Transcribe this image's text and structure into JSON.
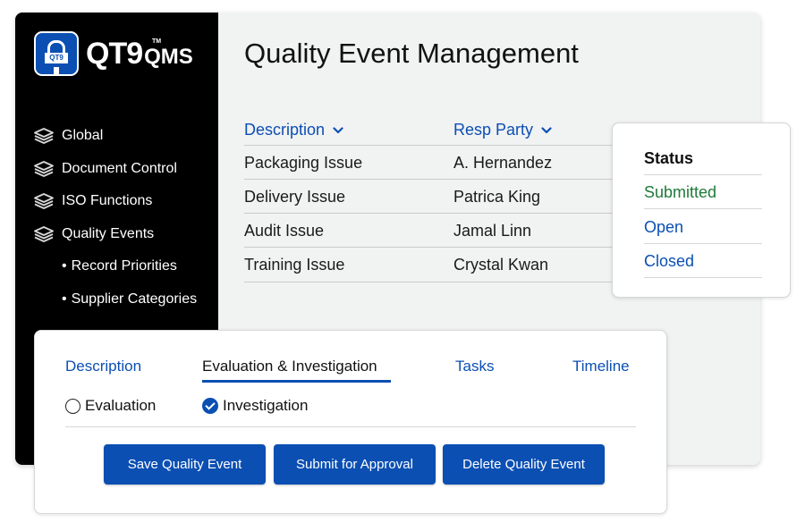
{
  "app": {
    "logo_text": "QT9",
    "logo_tm": "TM",
    "logo_suffix": "QMS",
    "logo_badge_text": "QT9"
  },
  "sidebar": {
    "items": [
      {
        "label": "Global",
        "icon": "layers-icon"
      },
      {
        "label": "Document Control",
        "icon": "layers-icon"
      },
      {
        "label": "ISO Functions",
        "icon": "layers-icon"
      },
      {
        "label": "Quality Events",
        "icon": "layers-icon"
      }
    ],
    "subitems": [
      {
        "label": "Record Priorities"
      },
      {
        "label": "Supplier Categories"
      }
    ]
  },
  "page": {
    "title": "Quality Event Management"
  },
  "table": {
    "headers": [
      "Description",
      "Resp Party"
    ],
    "rows": [
      {
        "description": "Packaging Issue",
        "resp_party": "A. Hernandez"
      },
      {
        "description": "Delivery Issue",
        "resp_party": "Patrica King"
      },
      {
        "description": "Audit Issue",
        "resp_party": "Jamal Linn"
      },
      {
        "description": "Training Issue",
        "resp_party": "Crystal Kwan"
      }
    ]
  },
  "status_popup": {
    "header": "Status",
    "options": [
      {
        "label": "Submitted",
        "color": "#1e7a39"
      },
      {
        "label": "Open",
        "color": "#0b4fb3"
      },
      {
        "label": "Closed",
        "color": "#0b4fb3"
      }
    ]
  },
  "form": {
    "tabs": [
      {
        "label": "Description",
        "active": false
      },
      {
        "label": "Evaluation & Investigation",
        "active": true
      },
      {
        "label": "Tasks",
        "active": false
      },
      {
        "label": "Timeline",
        "active": false
      }
    ],
    "options": [
      {
        "label": "Evaluation",
        "checked": false
      },
      {
        "label": "Investigation",
        "checked": true
      }
    ],
    "buttons": {
      "save": "Save Quality Event",
      "submit": "Submit for Approval",
      "delete": "Delete Quality Event"
    }
  },
  "colors": {
    "accent": "#0b4fb3",
    "sidebar_bg": "#000000",
    "content_bg": "#f1f2f2",
    "submitted": "#1e7a39"
  }
}
